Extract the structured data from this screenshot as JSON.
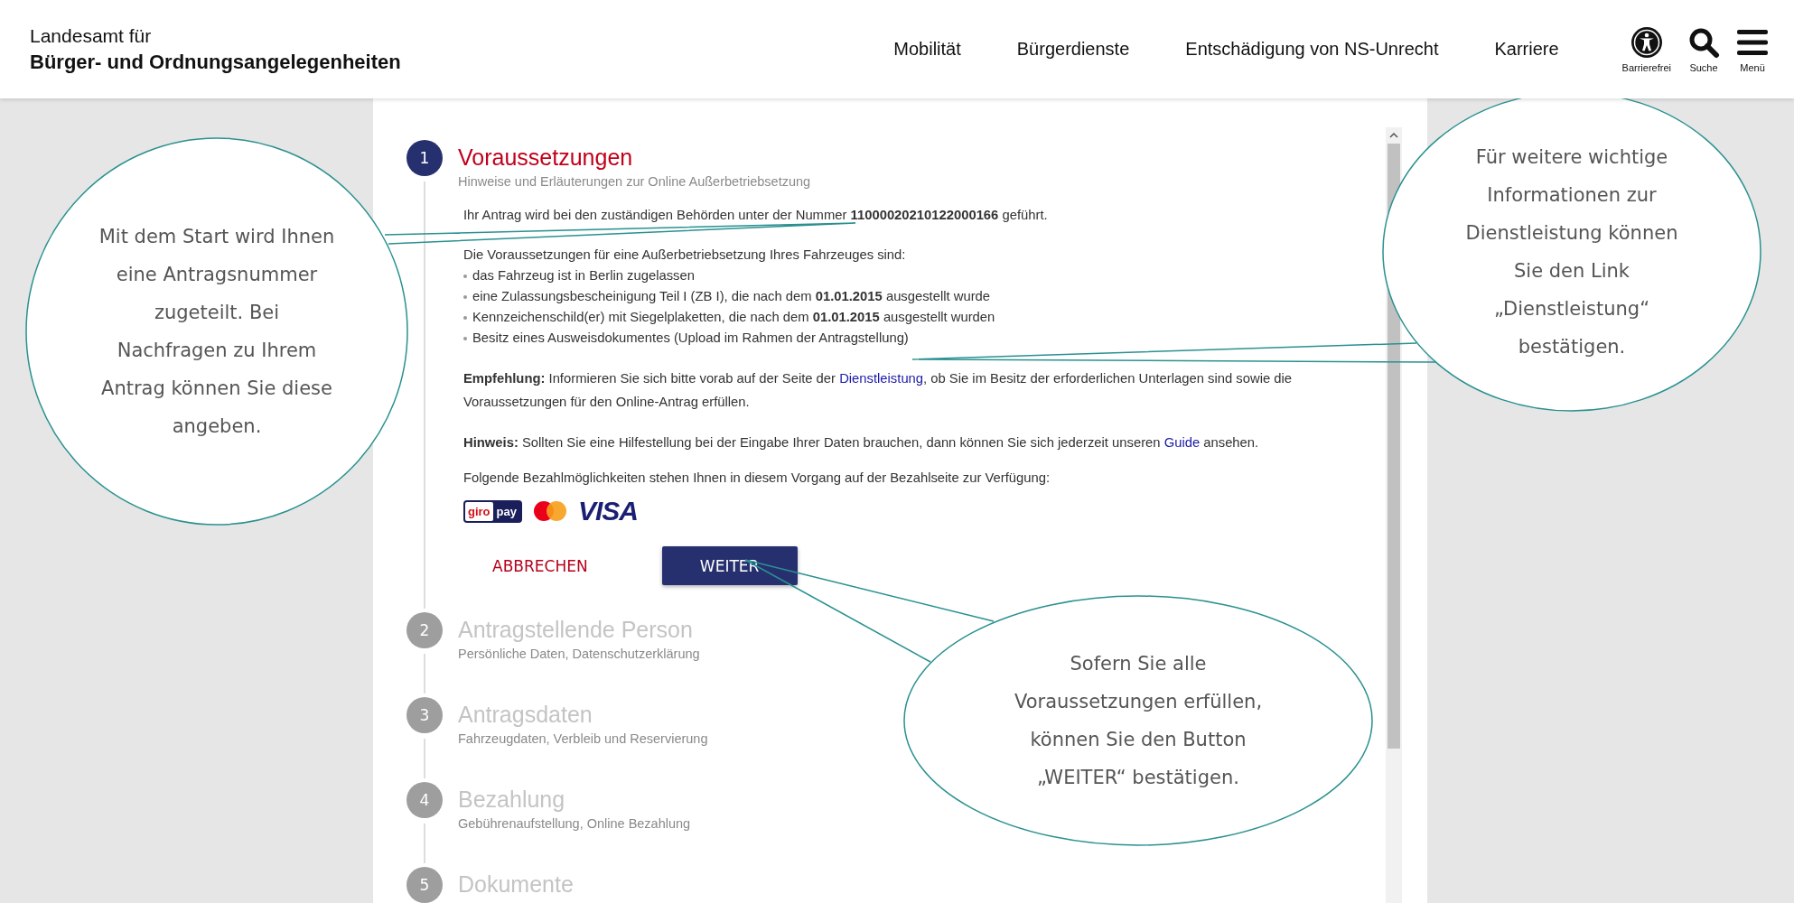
{
  "header": {
    "title": "Landesamt für",
    "subtitle": "Bürger- und Ordnungsangelegenheiten",
    "nav": [
      "Mobilität",
      "Bürgerdienste",
      "Entschädigung von NS-Unrecht",
      "Karriere"
    ],
    "tools": [
      {
        "kind": "accessibility",
        "label": "Barrierefrei"
      },
      {
        "kind": "search",
        "label": "Suche"
      },
      {
        "kind": "menu",
        "label": "Menü"
      }
    ]
  },
  "steps": [
    {
      "number": "1",
      "title": "Voraussetzungen",
      "subtitle": "Hinweise und Erläuterungen zur Online Außerbetriebsetzung",
      "active": true,
      "content": {
        "application_number_text": "Ihr Antrag wird bei den zuständigen Behörden unter der Nummer **11000020210122000166** geführt.",
        "requirements_intro": "Die Voraussetzungen für eine Außerbetriebsetzung Ihres Fahrzeuges sind:",
        "requirements": [
          "das Fahrzeug ist in Berlin zugelassen",
          "eine Zulassungsbescheinigung Teil I (ZB I), die nach dem **01.01.2015** ausgestellt wurde",
          "Kennzeichenschild(er) mit Siegelplaketten, die nach dem **01.01.2015** ausgestellt wurden",
          "Besitz eines Ausweisdokumentes (Upload im Rahmen der Antragstellung)"
        ],
        "recommendation": {
          "before": "**Empfehlung:** Informieren Sie sich bitte vorab auf der Seite der ",
          "link": "Dienstleistung",
          "after": ", ob Sie im Besitz der erforderlichen Unterlagen sind sowie die Voraussetzungen für den Online-Antrag erfüllen."
        },
        "hint": {
          "before": "**Hinweis:** Sollten Sie eine Hilfestellung bei der Eingabe Ihrer Daten brauchen, dann können Sie sich jederzeit unseren ",
          "link": "Guide",
          "after": " ansehen."
        },
        "payment_text": "Folgende Bezahlmöglichkeiten stehen Ihnen in diesem Vorgang auf der Bezahlseite zur Verfügung:",
        "payment_methods": [
          {
            "kind": "giropay",
            "text_1": "giro",
            "text_2": "pay"
          },
          {
            "kind": "mastercard"
          },
          {
            "kind": "visa",
            "text": "VISA"
          }
        ],
        "buttons": [
          {
            "kind": "secondary",
            "label": "ABBRECHEN"
          },
          {
            "kind": "primary",
            "label": "WEITER"
          }
        ]
      }
    },
    {
      "number": "2",
      "title": "Antragstellende Person",
      "subtitle": "Persönliche Daten, Datenschutzerklärung",
      "active": false
    },
    {
      "number": "3",
      "title": "Antragsdaten",
      "subtitle": "Fahrzeugdaten, Verbleib und Reservierung",
      "active": false
    },
    {
      "number": "4",
      "title": "Bezahlung",
      "subtitle": "Gebührenaufstellung, Online Bezahlung",
      "active": false
    },
    {
      "number": "5",
      "title": "Dokumente",
      "active": false
    }
  ],
  "callouts": [
    {
      "text": "Mit dem Start wird Ihnen eine Antragsnummer zugeteilt. Bei Nachfragen zu Ihrem Antrag können Sie diese angeben."
    },
    {
      "text": "Für weitere wichtige Informationen zur Dienstleistung können Sie den Link „Dienstleistung“ bestätigen."
    },
    {
      "text": "Sofern Sie alle Voraussetzungen erfüllen, können Sie den Button „WEITER“ bestätigen."
    }
  ]
}
